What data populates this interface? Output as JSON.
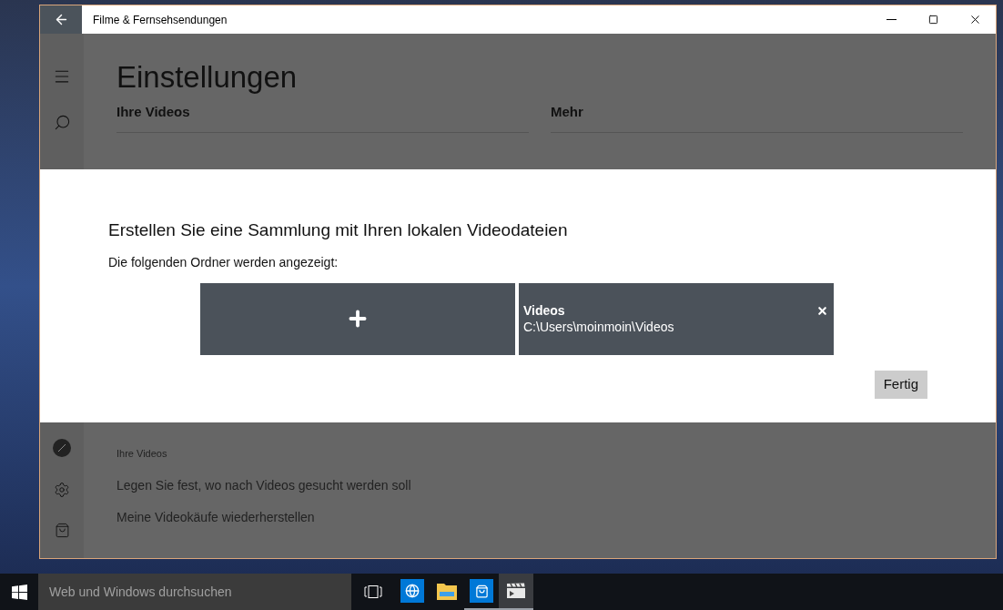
{
  "window": {
    "title": "Filme & Fernsehsendungen"
  },
  "page": {
    "title": "Einstellungen",
    "sections": [
      {
        "heading": "Ihre Videos"
      },
      {
        "heading": "Mehr"
      }
    ]
  },
  "dialog": {
    "title": "Erstellen Sie eine Sammlung mit Ihren lokalen Videodateien",
    "subtitle": "Die folgenden Ordner werden angezeigt:",
    "folders": [
      {
        "name": "Videos",
        "path": "C:\\Users\\moinmoin\\Videos"
      }
    ],
    "button": "Fertig"
  },
  "settings": {
    "heading": "Ihre Videos",
    "links": [
      "Legen Sie fest, wo nach Videos gesucht werden soll",
      "Meine Videokäufe wiederherstellen"
    ]
  },
  "taskbar": {
    "search": {
      "placeholder": "Web und Windows durchsuchen"
    },
    "apps": [
      {
        "kind": "browser",
        "running": false,
        "selected": false
      },
      {
        "kind": "explorer",
        "running": false,
        "selected": false
      },
      {
        "kind": "store",
        "running": true,
        "selected": false
      },
      {
        "kind": "video",
        "running": true,
        "selected": true
      }
    ]
  }
}
